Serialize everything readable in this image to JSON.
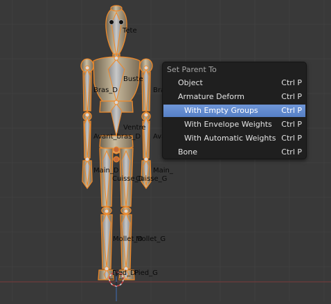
{
  "viewport": {
    "bone_labels": [
      "Tete",
      "Buste",
      "Bras_D",
      "Bras_",
      "Ventre",
      "Avant_bras_D",
      "Avan",
      "Main_D",
      "Main_",
      "Cuisse_D",
      "Cuisse_G",
      "Mollet_D",
      "Mollet_G",
      "Pied_D",
      "Pied_G"
    ]
  },
  "menu": {
    "title": "Set Parent To",
    "items": [
      {
        "label": "Object",
        "shortcut": "Ctrl P"
      },
      {
        "label": "Armature Deform",
        "shortcut": "Ctrl P"
      },
      {
        "label": "With Empty Groups",
        "shortcut": "Ctrl P"
      },
      {
        "label": "With Envelope Weights",
        "shortcut": "Ctrl P"
      },
      {
        "label": "With Automatic Weights",
        "shortcut": "Ctrl P"
      },
      {
        "label": "Bone",
        "shortcut": "Ctrl P"
      }
    ]
  },
  "colors": {
    "background": "#393939",
    "menu_background": "#1f1f1f",
    "highlight": "#5f8ad0",
    "selection_outline": "#f08a2a"
  },
  "icons": [
    "cursor-3d-icon"
  ]
}
